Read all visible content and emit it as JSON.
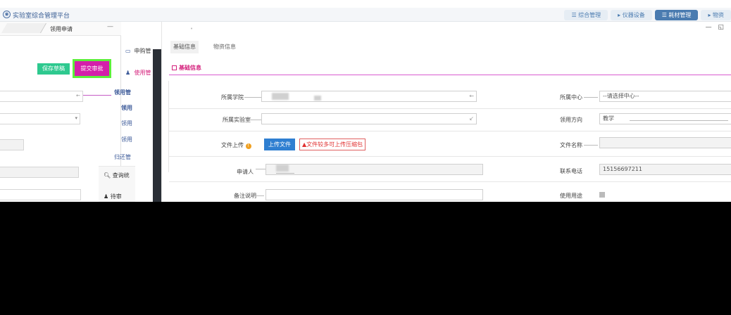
{
  "system": {
    "title": "实验室综合管理平台",
    "logo_icon": "university-seal-icon",
    "nav": [
      {
        "label": "☰ 综合管理",
        "active": false
      },
      {
        "label": "▸ 仪器设备",
        "active": false
      },
      {
        "label": "☰ 耗材管理",
        "active": true
      },
      {
        "label": "▸ 物资",
        "active": false
      }
    ]
  },
  "left_dialog": {
    "title": "领用申请",
    "minimize": "—",
    "save_label": "保存草稿",
    "submit_label": "提交审批",
    "colors": {
      "save": "#2ec98f",
      "submit": "#d41faa",
      "highlight": "#5cf03a"
    }
  },
  "menu": {
    "items": [
      {
        "label": "申购管",
        "icon": "monitor-icon"
      },
      {
        "label": "使用管",
        "icon": "user-icon"
      }
    ],
    "subitems": [
      "领用管",
      "领用",
      "领用",
      "领用",
      "归还管"
    ],
    "query_label": "查询统",
    "approval_label": "待审",
    "query_icon": "search-icon",
    "approval_icon": "person-icon"
  },
  "main": {
    "window_controls": "— ◱",
    "tabs": [
      {
        "label": "基础信息",
        "active": true
      },
      {
        "label": "物资信息",
        "active": false
      }
    ],
    "section_title": "基础信息",
    "form": {
      "college_label": "所属学院",
      "center_label": "所属中心",
      "center_value": "--请选择中心--",
      "lab_label": "所属实验室",
      "direction_label": "领用方向",
      "direction_value": "教学",
      "attachment_label": "文件上传",
      "upload_button": "上传文件",
      "upload_warning": "文件较多可上传压缩包",
      "filename_label": "文件名称",
      "applicant_label": "申请人",
      "phone_label": "联系电话",
      "phone_value": "15156697211",
      "remark_label": "备注说明",
      "purpose_label": "使用用途"
    }
  }
}
